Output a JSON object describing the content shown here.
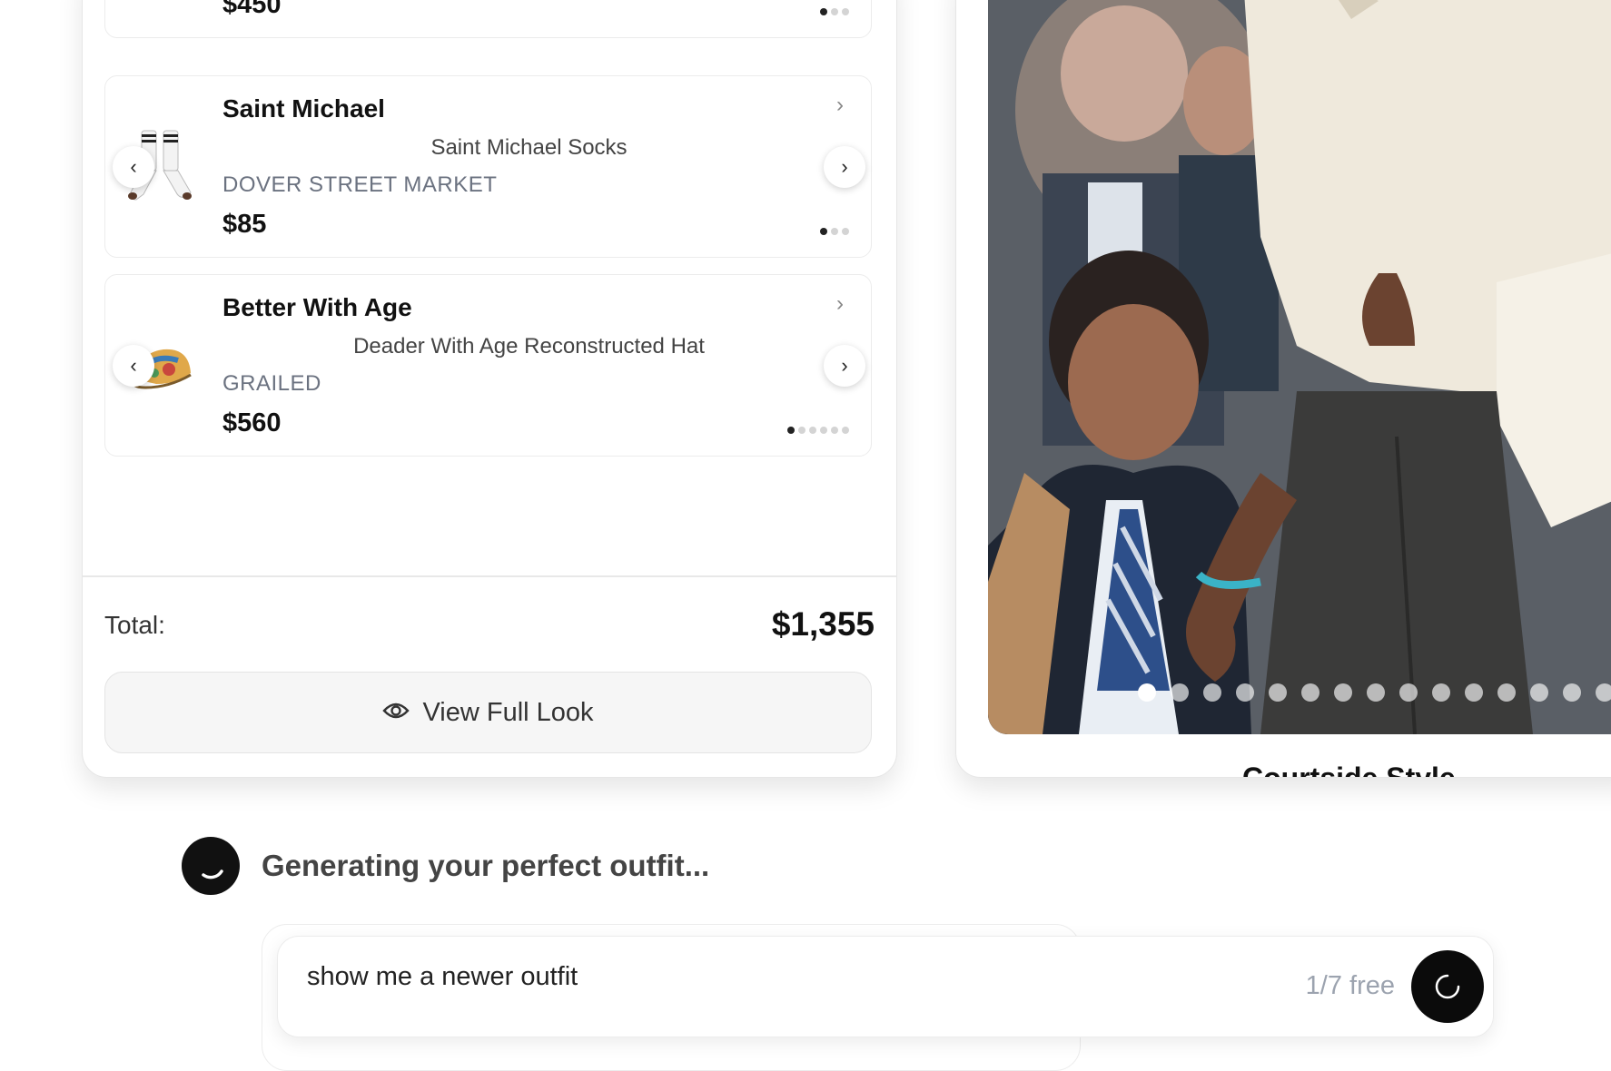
{
  "outfit_items": [
    {
      "brand": "",
      "product_name": "",
      "store": "",
      "price": "$450",
      "image_icon": "product-thumbnail-icon",
      "image_count": 3,
      "active_image": 1
    },
    {
      "brand": "Saint Michael",
      "product_name": "Saint Michael Socks",
      "store": "DOVER STREET MARKET",
      "price": "$85",
      "image_icon": "socks-icon",
      "image_count": 3,
      "active_image": 1
    },
    {
      "brand": "Better With Age",
      "product_name": "Deader With Age Reconstructed Hat",
      "store": "GRAILED",
      "price": "$560",
      "image_icon": "hat-icon",
      "image_count": 6,
      "active_image": 1
    }
  ],
  "total": {
    "label": "Total:",
    "value": "$1,355"
  },
  "view_button": {
    "label": "View Full Look",
    "icon": "eye-icon"
  },
  "right_panel": {
    "photo_icon": "outfit-photo",
    "photo_dot_count": 15,
    "active_photo": 1,
    "title_partial": "Courtside Style"
  },
  "status": {
    "text": "Generating your perfect outfit...",
    "icon": "loading-spinner-icon"
  },
  "chat_input": {
    "value": "show me a newer outfit",
    "quota": "1/7 free",
    "send_icon": "loading-spinner-icon"
  },
  "colors": {
    "accent_dark": "#0b0b0b",
    "muted_text": "#6b7280",
    "quota_text": "#9ca3af"
  }
}
